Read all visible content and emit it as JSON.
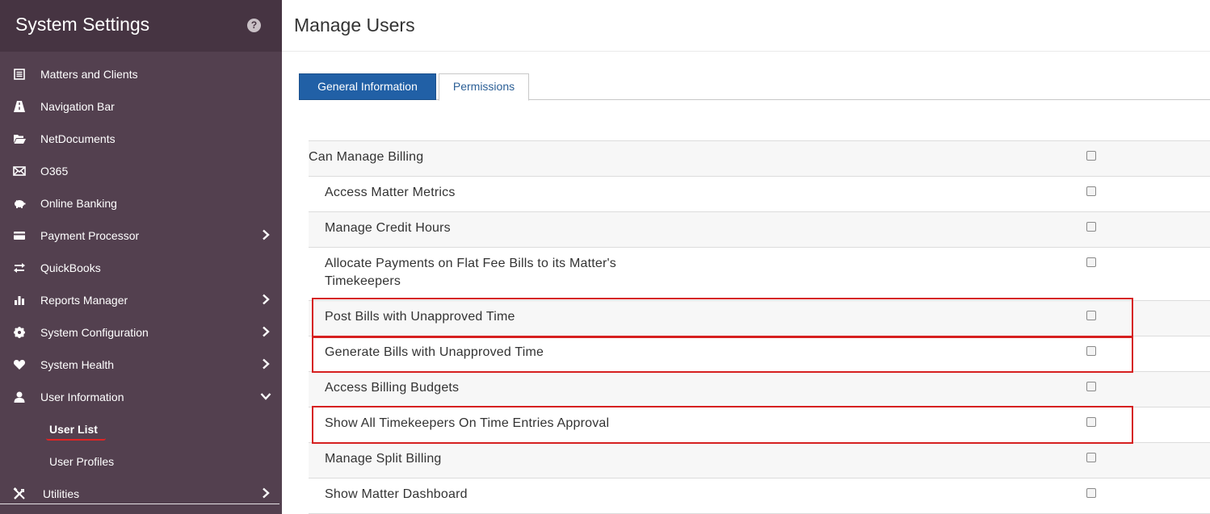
{
  "sidebar": {
    "title": "System Settings",
    "help_icon": "?",
    "items": [
      {
        "label": "Matters and Clients",
        "icon": "list-icon",
        "chevron": ""
      },
      {
        "label": "Navigation Bar",
        "icon": "road-icon",
        "chevron": ""
      },
      {
        "label": "NetDocuments",
        "icon": "folder-open-icon",
        "chevron": ""
      },
      {
        "label": "O365",
        "icon": "envelope-icon",
        "chevron": ""
      },
      {
        "label": "Online Banking",
        "icon": "piggy-bank-icon",
        "chevron": ""
      },
      {
        "label": "Payment Processor",
        "icon": "credit-card-icon",
        "chevron": "right"
      },
      {
        "label": "QuickBooks",
        "icon": "swap-arrows-icon",
        "chevron": ""
      },
      {
        "label": "Reports Manager",
        "icon": "bar-chart-icon",
        "chevron": "right"
      },
      {
        "label": "System Configuration",
        "icon": "gear-icon",
        "chevron": "right"
      },
      {
        "label": "System Health",
        "icon": "heart-icon",
        "chevron": "right"
      },
      {
        "label": "User Information",
        "icon": "user-icon",
        "chevron": "down"
      }
    ],
    "sub_items": [
      {
        "label": "User List",
        "active": true
      },
      {
        "label": "User Profiles",
        "active": false
      }
    ],
    "last_item": {
      "label": "Utilities",
      "icon": "tools-icon",
      "chevron": "right"
    }
  },
  "main": {
    "title": "Manage Users",
    "tabs": [
      {
        "label": "General Information",
        "active": false
      },
      {
        "label": "Permissions",
        "active": true
      }
    ],
    "permissions": [
      {
        "label": "Can Manage Billing",
        "checked": false
      },
      {
        "label": "Access Matter Metrics",
        "checked": false
      },
      {
        "label": "Manage Credit Hours",
        "checked": false
      },
      {
        "label": "Allocate Payments on Flat Fee Bills to its Matter's Timekeepers",
        "checked": false
      },
      {
        "label": "Post Bills with Unapproved Time",
        "checked": false
      },
      {
        "label": "Generate Bills with Unapproved Time",
        "checked": false
      },
      {
        "label": "Access Billing Budgets",
        "checked": false
      },
      {
        "label": "Show All Timekeepers On Time Entries Approval",
        "checked": false
      },
      {
        "label": "Manage Split Billing",
        "checked": false
      },
      {
        "label": "Show Matter Dashboard",
        "checked": false
      }
    ]
  },
  "colors": {
    "sidebar_bg": "#53404f",
    "sidebar_header_bg": "#463442",
    "tab_active_bg": "#2160a6",
    "highlight": "#d62020"
  }
}
